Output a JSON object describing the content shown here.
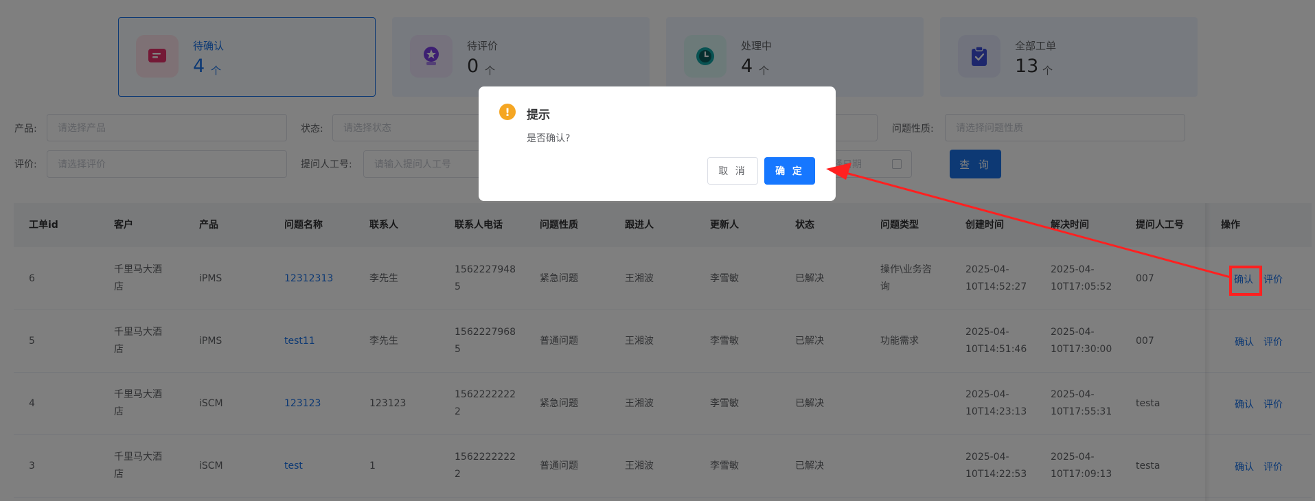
{
  "cards": [
    {
      "label": "待确认",
      "count": "4",
      "unit": "个",
      "icon": "message-icon",
      "icon_color": "#e8336d",
      "icon_bg": "#fde2ea",
      "active": true
    },
    {
      "label": "待评价",
      "count": "0",
      "unit": "个",
      "icon": "star-badge-icon",
      "icon_color": "#7b3fe4",
      "icon_bg": "#ece4fb"
    },
    {
      "label": "处理中",
      "count": "4",
      "unit": "个",
      "icon": "clock-icon",
      "icon_color": "#12a4a4",
      "icon_bg": "#d9f4f2"
    },
    {
      "label": "全部工单",
      "count": "13",
      "unit": "个",
      "icon": "clipboard-icon",
      "icon_color": "#3d4ed8",
      "icon_bg": "#e2e6fb"
    }
  ],
  "filters": {
    "product_label": "产品:",
    "product_placeholder": "请选择产品",
    "status_label": "状态:",
    "status_placeholder": "请选择状态",
    "nature_label": "问题性质:",
    "nature_placeholder": "请选择问题性质",
    "rating_label": "评价:",
    "rating_placeholder": "请选择评价",
    "requester_label": "提问人工号:",
    "requester_placeholder": "请输入提问人工号",
    "date_placeholder": "择日期",
    "query_button": "查 询"
  },
  "table": {
    "headers": [
      "工单id",
      "客户",
      "产品",
      "问题名称",
      "联系人",
      "联系人电话",
      "问题性质",
      "跟进人",
      "更新人",
      "状态",
      "问题类型",
      "创建时间",
      "解决时间",
      "提问人工号",
      "操作"
    ],
    "rows": [
      {
        "id": "6",
        "customer_l1": "千里马大酒",
        "customer_l2": "店",
        "product": "iPMS",
        "name": "12312313",
        "contact": "李先生",
        "phone_l1": "1562227948",
        "phone_l2": "5",
        "nature": "紧急问题",
        "follower": "王湘波",
        "updater": "李雪敏",
        "status": "已解决",
        "type_l1": "操作\\业务咨",
        "type_l2": "询",
        "created_l1": "2025-04-",
        "created_l2": "10T14:52:27",
        "resolved_l1": "2025-04-",
        "resolved_l2": "10T17:05:52",
        "requester": "007",
        "op_confirm": "确认",
        "op_rate": "评价"
      },
      {
        "id": "5",
        "customer_l1": "千里马大酒",
        "customer_l2": "店",
        "product": "iPMS",
        "name": "test11",
        "contact": "李先生",
        "phone_l1": "1562227968",
        "phone_l2": "5",
        "nature": "普通问题",
        "follower": "王湘波",
        "updater": "李雪敏",
        "status": "已解决",
        "type_l1": "功能需求",
        "type_l2": "",
        "created_l1": "2025-04-",
        "created_l2": "10T14:51:46",
        "resolved_l1": "2025-04-",
        "resolved_l2": "10T17:30:00",
        "requester": "007",
        "op_confirm": "确认",
        "op_rate": "评价"
      },
      {
        "id": "4",
        "customer_l1": "千里马大酒",
        "customer_l2": "店",
        "product": "iSCM",
        "name": "123123",
        "contact": "123123",
        "phone_l1": "1562222222",
        "phone_l2": "2",
        "nature": "紧急问题",
        "follower": "王湘波",
        "updater": "李雪敏",
        "status": "已解决",
        "type_l1": "",
        "type_l2": "",
        "created_l1": "2025-04-",
        "created_l2": "10T14:23:13",
        "resolved_l1": "2025-04-",
        "resolved_l2": "10T17:55:31",
        "requester": "testa",
        "op_confirm": "确认",
        "op_rate": "评价"
      },
      {
        "id": "3",
        "customer_l1": "千里马大酒",
        "customer_l2": "店",
        "product": "iSCM",
        "name": "test",
        "contact": "1",
        "phone_l1": "1562222222",
        "phone_l2": "2",
        "nature": "普通问题",
        "follower": "王湘波",
        "updater": "李雪敏",
        "status": "已解决",
        "type_l1": "",
        "type_l2": "",
        "created_l1": "2025-04-",
        "created_l2": "10T14:22:53",
        "resolved_l1": "2025-04-",
        "resolved_l2": "10T17:09:13",
        "requester": "testa",
        "op_confirm": "确认",
        "op_rate": "评价"
      }
    ]
  },
  "dialog": {
    "icon": "warning-icon",
    "icon_glyph": "!",
    "title": "提示",
    "message": "是否确认?",
    "cancel_label": "取 消",
    "ok_label": "确 定"
  },
  "colors": {
    "accent": "#1a73e8",
    "annotation": "#ff2020",
    "warning": "#f5a623"
  }
}
